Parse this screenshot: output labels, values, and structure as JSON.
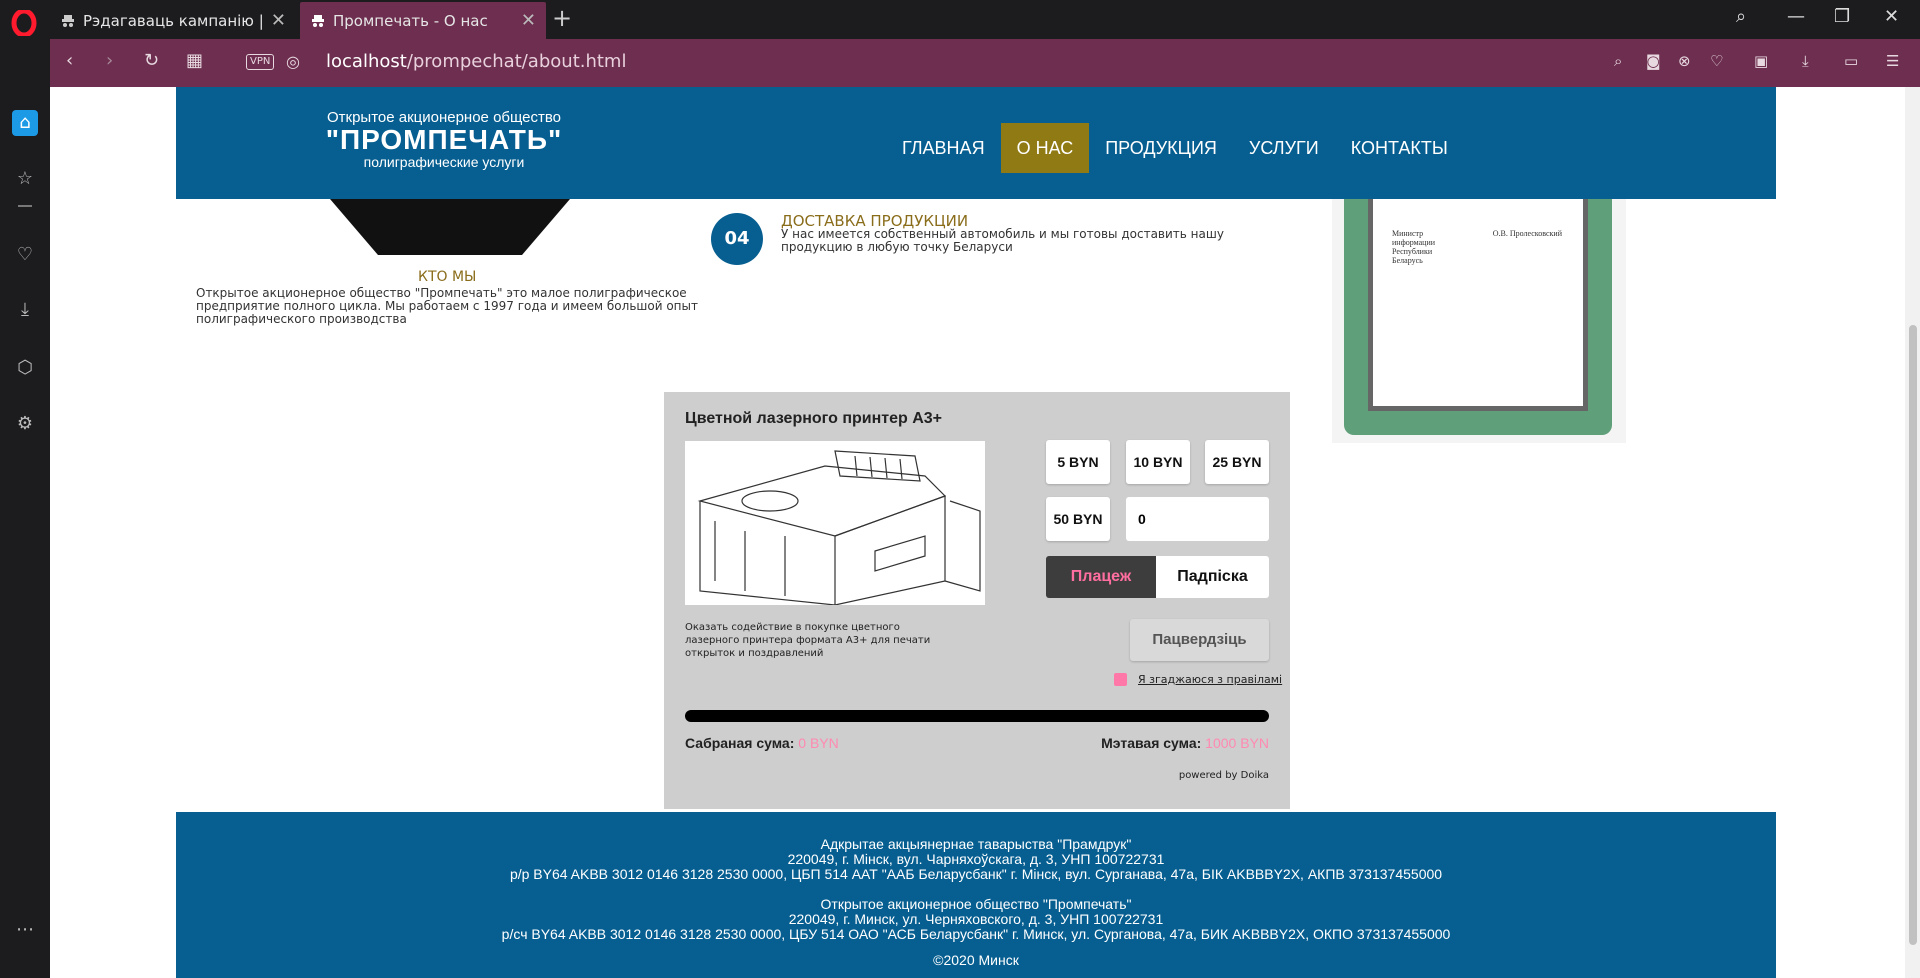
{
  "browser": {
    "tabs": [
      {
        "title": "Рэдагаваць кампанію | Do"
      },
      {
        "title": "Промпечать - О нас"
      }
    ],
    "address": {
      "vpn_label": "VPN",
      "host": "localhost",
      "path": "/prompechat/about.html"
    }
  },
  "site": {
    "logo": {
      "line1": "Открытое акционерное общество",
      "line2": "\"ПРОМПЕЧАТЬ\"",
      "line3": "полиграфические услуги"
    },
    "nav": [
      "ГЛАВНАЯ",
      "О НАС",
      "ПРОДУКЦИЯ",
      "УСЛУГИ",
      "КОНТАКТЫ"
    ],
    "who": {
      "title": "КТО МЫ",
      "text": "Открытое акционерное общество \"Промпечать\" это малое полиграфическое предприятие полного цикла. Мы работаем с 1997 года и имеем большой опыт полиграфического производства"
    },
    "step": {
      "number": "04",
      "title": "ДОСТАВКА ПРОДУКЦИИ",
      "text": "У нас имеется собственный автомобиль и мы готовы доставить нашу продукцию в любую точку Беларуси"
    },
    "certificate": {
      "signer_title": "Министр информации Республики Беларусь",
      "signer_name": "О.В. Пролесковский"
    }
  },
  "widget": {
    "title": "Цветной лазерного принтер А3+",
    "description": "Оказать содействие в покупке цветного лазерного принтера формата А3+ для печати открыток и поздравлений",
    "amounts": [
      "5 BYN",
      "10 BYN",
      "25 BYN",
      "50 BYN"
    ],
    "custom_amount": "0",
    "toggle": {
      "active": "Плацеж",
      "inactive": "Падпіска"
    },
    "confirm_label": "Пацвердзіць",
    "agree_label": "Я згаджаюся з правіламі",
    "progress": 0,
    "collected_label": "Сабраная сума:",
    "collected_value": "0 BYN",
    "goal_label": "Мэтавая сума:",
    "goal_value": "1000 BYN",
    "powered": "powered by Doika"
  },
  "footer": {
    "by_line1": "Адкрытае акцыянернае таварыства \"Прамдрук\"",
    "by_line2": "220049, г. Мінск, вул. Чарняхоўскага, д. 3, УНП 100722731",
    "by_line3": "р/р BY64 AKBB 3012 0146 3128 2530 0000, ЦБП 514 ААТ \"ААБ Беларусбанк\" г. Мінск, вул. Сурганава, 47а, БІК AKBBBY2X, АКПВ 373137455000",
    "ru_line1": "Открытое акционерное общество \"Промпечать\"",
    "ru_line2": "220049, г. Минск, ул. Черняховского, д. 3, УНП 100722731",
    "ru_line3": "р/сч BY64 AKBB 3012 0146 3128 2530 0000, ЦБУ 514 ОАО \"АСБ Беларусбанк\" г. Минск, ул. Сурганова, 47а, БИК AKBBBY2X, ОКПО 373137455000",
    "copyright": "©2020 Минск"
  },
  "colors": {
    "header_blue": "#075f91",
    "nav_active": "#8f7a14",
    "accent_pink": "#ff78a8",
    "browser_accent": "#6d2e4f"
  }
}
